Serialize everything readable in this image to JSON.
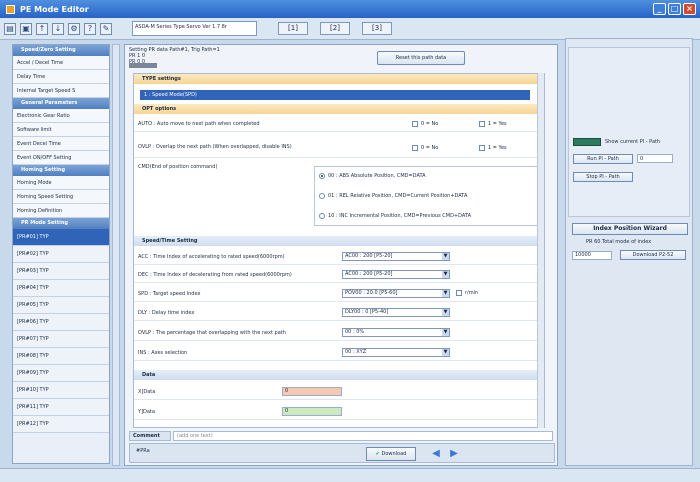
{
  "window": {
    "title": "PE Mode Editor"
  },
  "toolbar": {
    "type_box": "ASDA-M Series Type Servo Ver 1.7 8r",
    "nav_buttons": [
      "[1]",
      "[2]",
      "[3]"
    ]
  },
  "sidebar": {
    "section1": "Speed/Zero Setting",
    "items1": [
      "Accel / Decel Time",
      "Delay Time",
      "Internal Target Speed S"
    ],
    "section2": "General Parameters",
    "items2": [
      "Electronic Gear Ratio",
      "Software limit",
      "Event Decel Time",
      "Event ON/OFF Setting"
    ],
    "section3": "Homing Setting",
    "items3": [
      "Homing Mode",
      "Homing Speed Setting",
      "Homing Definition"
    ],
    "section4": "PR Mode Setting",
    "pr_items": [
      "[PR#01]   TYP",
      "[PR#02]   TYP",
      "[PR#03]   TYP",
      "[PR#04]   TYP",
      "[PR#05]   TYP",
      "[PR#06]   TYP",
      "[PR#07]   TYP",
      "[PR#08]   TYP",
      "[PR#09]   TYP",
      "[PR#10]   TYP",
      "[PR#11]   TYP",
      "[PR#12]   TYP"
    ]
  },
  "content": {
    "header_line1": "Setting PR data Path#1, Trig Path=1",
    "header_line2": "PR 1 0",
    "header_line3": "PR 0 0",
    "reset_button": "Reset this path data",
    "type_section": "TYPE settings",
    "type_value": "1 : Speed Mode(SPD)",
    "opt_section": "OPT options",
    "auto_row": "AUTO : Auto move to next path when completed",
    "ovlp_row": "OVLP : Overlap the next path (When overlapped, disable INS)",
    "opt_choice_a": "0 = No",
    "opt_choice_b": "1 = Yes",
    "cmd_row": "CMD(End of position command)",
    "radio_1": "00 : ABS Absolute Position, CMD=DATA",
    "radio_2": "01 : REL Relative Position, CMD=Current Position+DATA",
    "radio_3": "10 : INC Incremental Position, CMD=Previous CMD+DATA",
    "speed_section": "Speed/Time Setting",
    "acc_row": "ACC : Time Index of accelerating to rated speed(6000rpm)",
    "acc_value": "AC00 : 200 [P5-20]",
    "dec_row": "DEC : Time Index of decelerating from rated speed(6000rpm)",
    "dec_value": "AC00 : 200 [P5-20]",
    "spd_row": "SPD : Target speed Index",
    "spd_value": "POV00 : 20.0 [P5-60]",
    "spd_check": "r/min",
    "dly_row": "DLY : Delay time index",
    "dly_value": "DLY00 : 0 [P5-40]",
    "ovlp2_row": "OVLP : The percentage that overlapping with the next path",
    "ovlp2_value": "00 : 0%",
    "ins_row": "INS : Axes selection",
    "ins_value": "00 : XYZ",
    "data_section": "Data",
    "data_x": "X]Data",
    "data_x_val": "0",
    "data_y": "Y]Data",
    "data_y_val": "0",
    "comment_label": "Comment",
    "comment_placeholder": "(add one text)",
    "bottom_text": "#PRa",
    "download_button": "Download"
  },
  "right_panel": {
    "toggle_label": "Show current PI - Path",
    "run_button": "Run PI - Path",
    "run_value": "0",
    "stop_button": "Stop PI - Path",
    "wizard_button": "Index Position Wizard",
    "index_label": "PR 60 Total mode of index",
    "index_value": "10000",
    "download_button": "Download P2-52"
  }
}
